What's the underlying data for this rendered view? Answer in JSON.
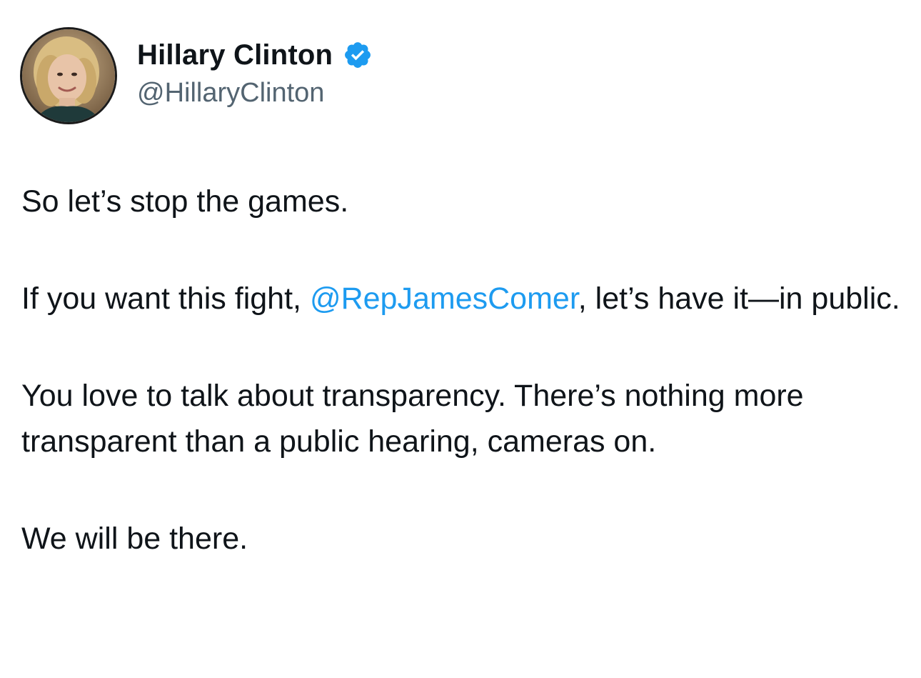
{
  "tweet": {
    "author": {
      "display_name": "Hillary Clinton",
      "handle": "@HillaryClinton",
      "verified_icon": "verified-badge-icon",
      "avatar_icon": "avatar-photo"
    },
    "paragraphs": [
      {
        "text": "So let’s stop the games."
      },
      {
        "before": "If you want this fight, ",
        "mention": "@RepJamesComer",
        "after": ", let’s have it—in public."
      },
      {
        "text": "You love to talk about transparency. There’s nothing more transparent than a public hearing, cameras on."
      },
      {
        "text": "We will be there."
      }
    ]
  },
  "colors": {
    "text": "#0f1419",
    "handle": "#536471",
    "link": "#1d9bf0",
    "verified": "#1d9bf0",
    "background": "#ffffff"
  }
}
